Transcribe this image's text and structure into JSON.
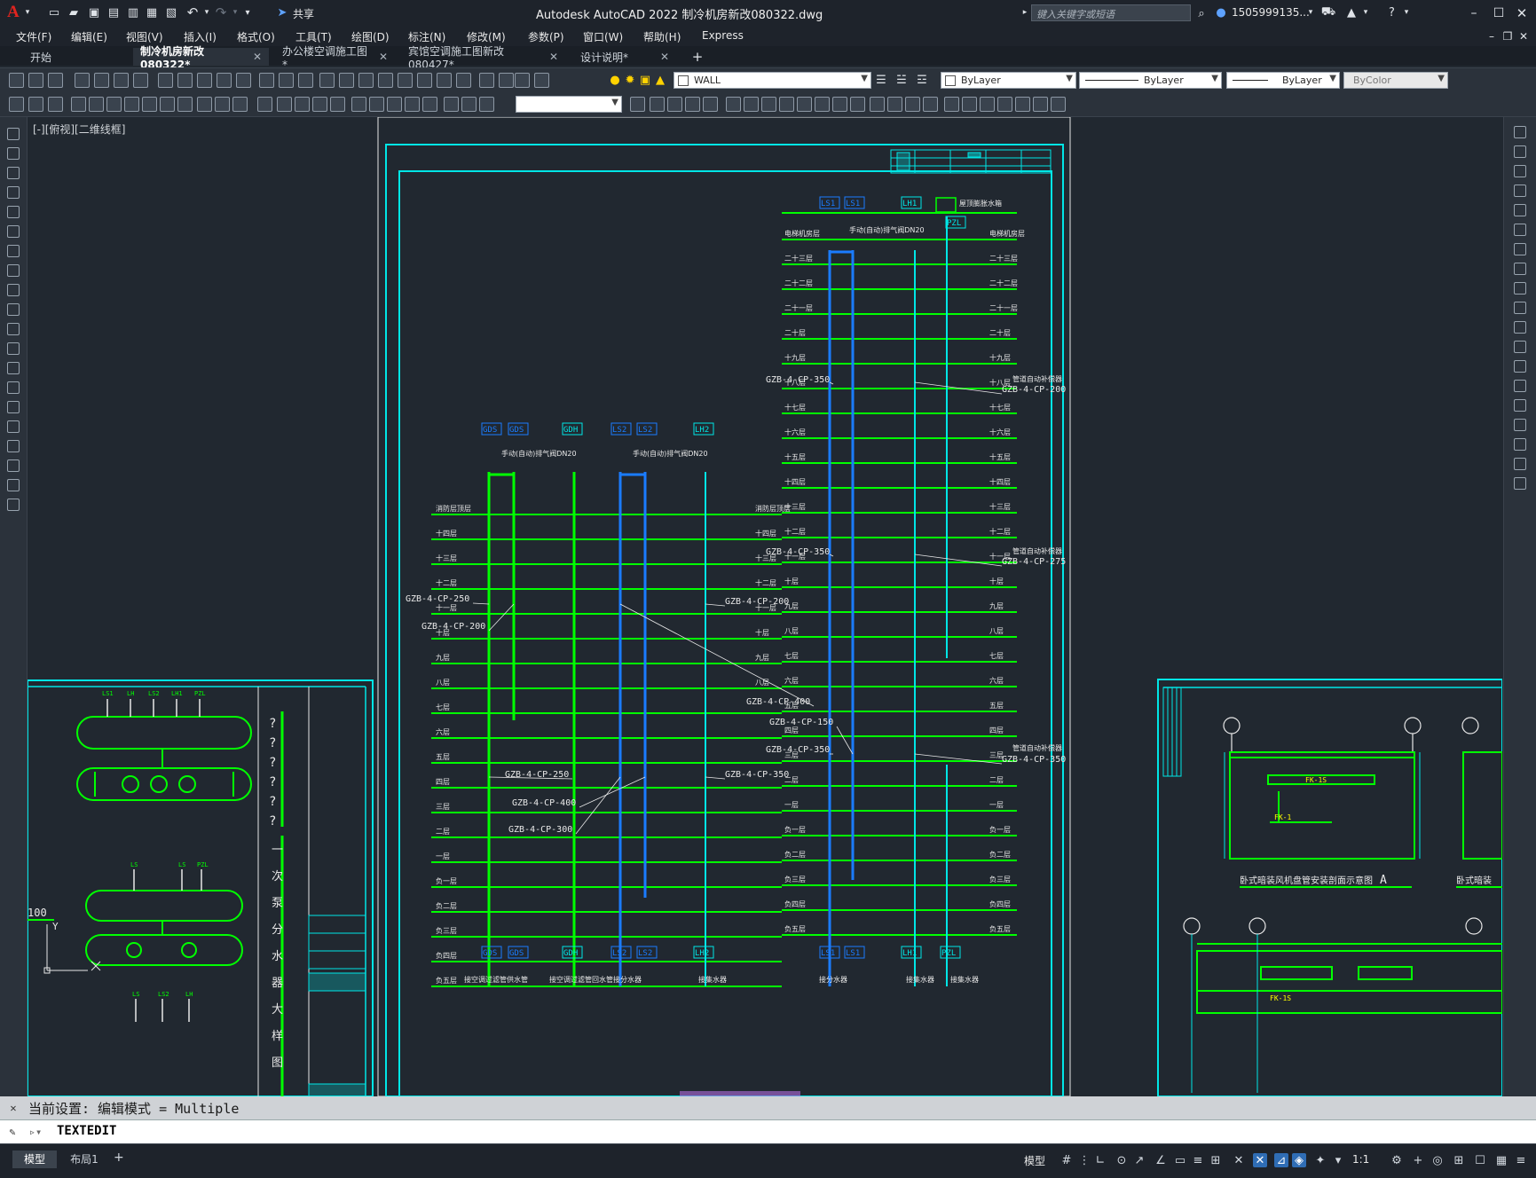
{
  "app": {
    "title": "Autodesk AutoCAD 2022    制冷机房新改080322.dwg",
    "logo": "A",
    "share_label": "共享",
    "search_placeholder": "键入关键字或短语",
    "user": "1505999135...",
    "window_icons": [
      "minimize-icon",
      "restore-icon",
      "close-icon"
    ]
  },
  "menu": [
    "文件(F)",
    "编辑(E)",
    "视图(V)",
    "插入(I)",
    "格式(O)",
    "工具(T)",
    "绘图(D)",
    "标注(N)",
    "修改(M)",
    "参数(P)",
    "窗口(W)",
    "帮助(H)",
    "Express"
  ],
  "tabs": [
    {
      "label": "开始",
      "active": false,
      "closable": false
    },
    {
      "label": "制冷机房新改080322*",
      "active": true,
      "closable": true
    },
    {
      "label": "办公楼空调施工图*",
      "active": false,
      "closable": true
    },
    {
      "label": "宾馆空调施工图新改080427*",
      "active": false,
      "closable": true
    },
    {
      "label": "设计说明*",
      "active": false,
      "closable": true
    }
  ],
  "properties": {
    "layer": "WALL",
    "color": "ByLayer",
    "linetype": "ByLayer",
    "lineweight": "ByLayer",
    "plotstyle": "ByColor"
  },
  "viewport_label": "[-][俯视][二维线框]",
  "drawing": {
    "top_tags_right": [
      "LS1",
      "LS1",
      "LH1"
    ],
    "top_tags_left": [
      "GDS",
      "GDS",
      "GDH",
      "LS2",
      "LS2",
      "LH2"
    ],
    "bottom_tags_left": [
      "GDS",
      "GDS",
      "GDH",
      "LS2",
      "LS2",
      "LH2"
    ],
    "bottom_tags_right": [
      "LS1",
      "LS1",
      "LH1",
      "PZL"
    ],
    "pzl_tag": "PZL",
    "roof_label": "屋顶膨胀水箱",
    "vent_label_right": "手动(自动)排气阀DN20",
    "vent_label_left1": "手动(自动)排气阀DN20",
    "vent_label_left2": "手动(自动)排气阀DN20",
    "floors_right": [
      "电梯机房层",
      "二十三层",
      "二十二层",
      "二十一层",
      "二十层",
      "十九层",
      "十八层",
      "十七层",
      "十六层",
      "十五层",
      "十四层",
      "十三层",
      "十二层",
      "十一层",
      "十层",
      "九层",
      "八层",
      "七层",
      "六层",
      "五层",
      "四层",
      "三层",
      "二层",
      "一层",
      "负一层",
      "负二层",
      "负三层",
      "负四层",
      "负五层"
    ],
    "floors_left": [
      "消防层顶层",
      "十四层",
      "十三层",
      "十二层",
      "十一层",
      "十层",
      "九层",
      "八层"
    ],
    "floors_low": [
      "七层",
      "六层",
      "五层",
      "四层",
      "三层",
      "二层",
      "一层",
      "负一层",
      "负二层",
      "负三层",
      "负四层",
      "负五层"
    ],
    "annotations": [
      {
        "text": "GZB-4-CP-350",
        "side": "left"
      },
      {
        "text": "GZB-4-CP-200",
        "side": "right"
      },
      {
        "text": "GZB-4-CP-350",
        "side": "left"
      },
      {
        "text": "GZB-4-CP-275",
        "side": "right"
      },
      {
        "text": "GZB-4-CP-250",
        "side": "left"
      },
      {
        "text": "GZB-4-CP-200",
        "side": "left"
      },
      {
        "text": "GZB-4-CP-200",
        "side": "right"
      },
      {
        "text": "GZB-4-CP-400",
        "side": "mid"
      },
      {
        "text": "GZB-4-CP-150",
        "side": "mid"
      },
      {
        "text": "GZB-4-CP-350",
        "side": "mid"
      },
      {
        "text": "GZB-4-CP-350",
        "side": "right"
      },
      {
        "text": "GZB-4-CP-250",
        "side": "left"
      },
      {
        "text": "GZB-4-CP-350",
        "side": "right"
      },
      {
        "text": "GZB-4-CP-400",
        "side": "left"
      },
      {
        "text": "GZB-4-CP-300",
        "side": "left"
      }
    ],
    "compensator_label": "管道自动补偿器",
    "bottom_labels": [
      "接空调过滤管供水管",
      "接空调过滤管回水管",
      "接分水器",
      "接集水器",
      "接分水器",
      "接集水器",
      "接集水器"
    ],
    "left_panel_labels": [
      "?",
      "?",
      "?",
      "?",
      "?",
      "?"
    ],
    "left_panel_vertical": [
      "一",
      "次",
      "泵",
      "分",
      "水",
      "器",
      "大",
      "样",
      "图"
    ],
    "left_panel_header_tags": [
      "LS1",
      "LH",
      "LS2",
      "LH1",
      "PZL"
    ],
    "left_panel_tags_2": [
      "LS",
      "LS",
      "PZL"
    ],
    "left_panel_tags_3": [
      "LS",
      "LS2",
      "LH"
    ],
    "right_panel_title": "卧式暗装风机盘管安装剖面示意图",
    "right_panel_letter": "A",
    "right_panel_title2": "卧式暗装",
    "right_panel_labels": [
      "FK-1",
      "FK-1S",
      "FK-1S"
    ],
    "axis_label": "100",
    "axis_y": "Y"
  },
  "command": {
    "history": "当前设置: 编辑模式 = Multiple",
    "current": "TEXTEDIT"
  },
  "status": {
    "model_tab": "模型",
    "layout_tab": "布局1",
    "add_tab": "+",
    "model_button": "模型",
    "scale": "1:1"
  },
  "colors": {
    "green": "#00ff00",
    "blue": "#1a7cff",
    "cyan": "#00e6e6",
    "white": "#e8e8e8",
    "background": "#212830"
  }
}
